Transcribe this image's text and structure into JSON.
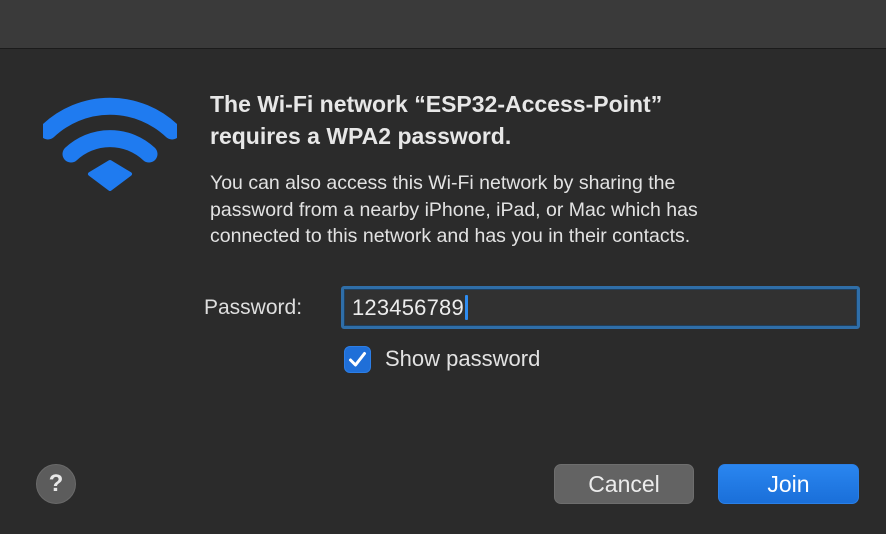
{
  "dialog": {
    "heading": "The Wi-Fi network “ESP32-Access-Point”\nrequires a WPA2 password.",
    "description": "You can also access this Wi-Fi network by sharing the\npassword from a nearby iPhone, iPad, or Mac which has\nconnected to this network and has you in their contacts.",
    "icon": "wifi-icon",
    "accent_color": "#1f7bf0"
  },
  "password": {
    "label": "Password:",
    "value": "123456789"
  },
  "show_password": {
    "label": "Show password",
    "checked": true
  },
  "buttons": {
    "help_label": "?",
    "cancel_label": "Cancel",
    "join_label": "Join"
  }
}
